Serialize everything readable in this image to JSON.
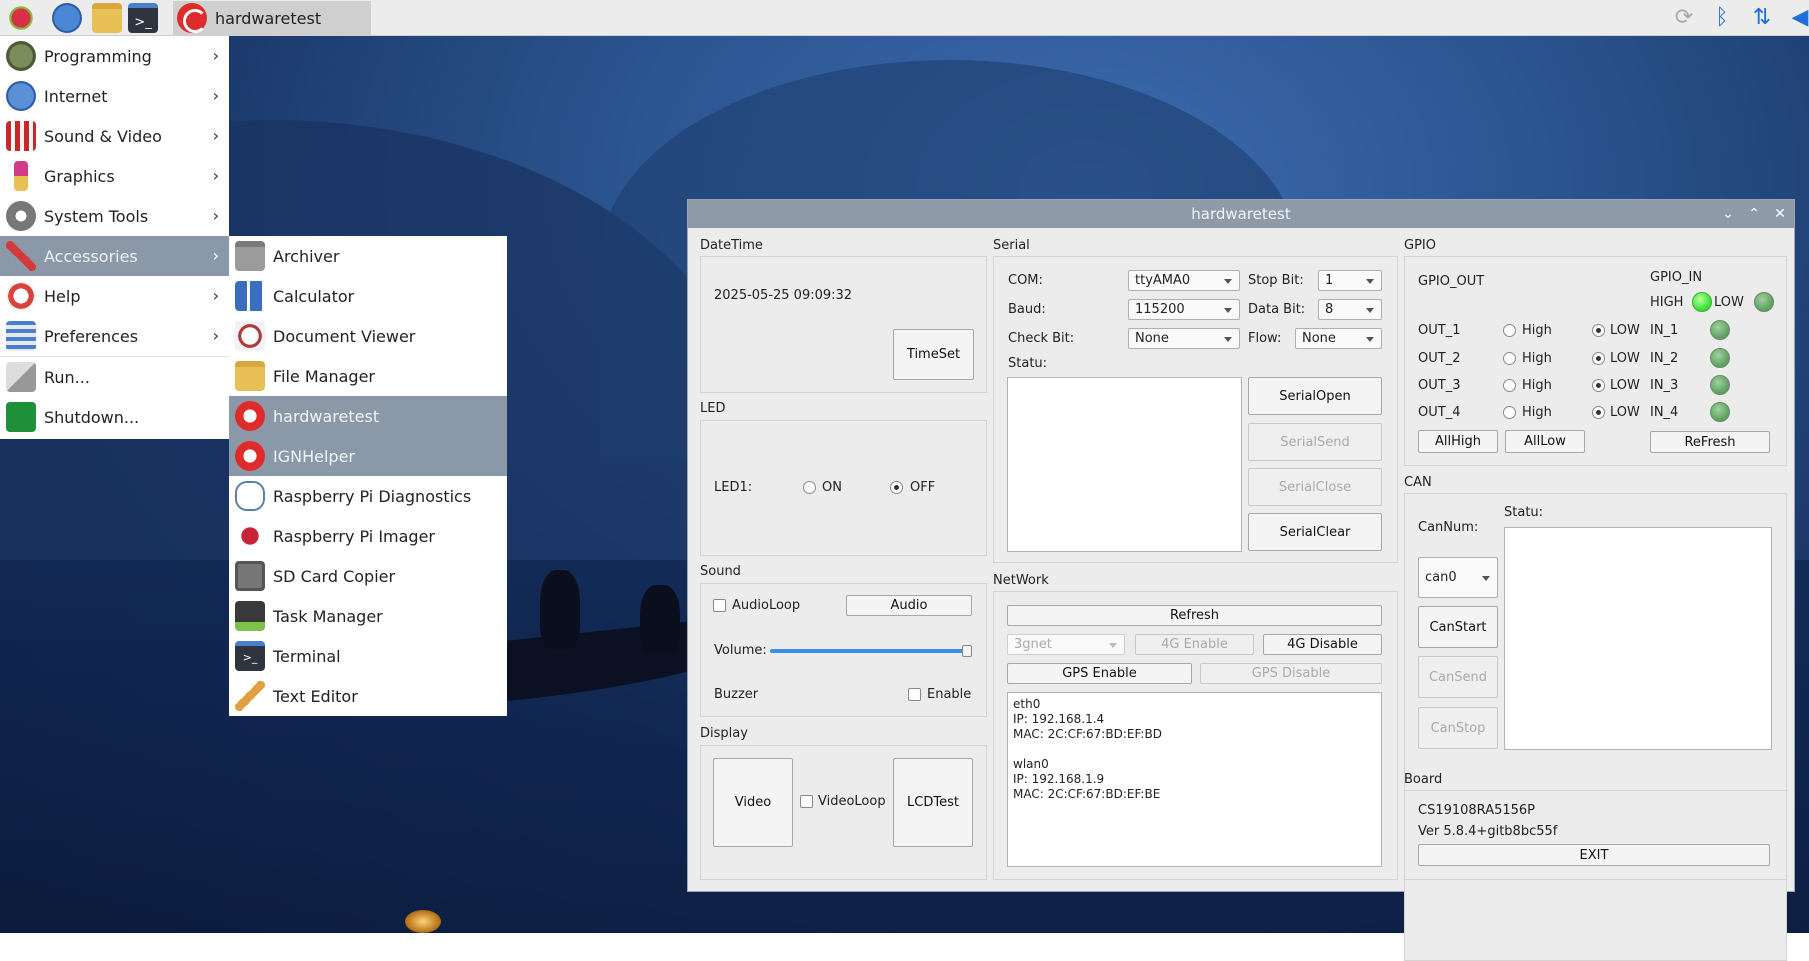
{
  "taskbar": {
    "app_title": "hardwaretest"
  },
  "main_menu": {
    "items": [
      {
        "label": "Programming"
      },
      {
        "label": "Internet"
      },
      {
        "label": "Sound & Video"
      },
      {
        "label": "Graphics"
      },
      {
        "label": "System Tools"
      },
      {
        "label": "Accessories"
      },
      {
        "label": "Help"
      },
      {
        "label": "Preferences"
      },
      {
        "label": "Run..."
      },
      {
        "label": "Shutdown..."
      }
    ]
  },
  "submenu": {
    "items": [
      {
        "label": "Archiver"
      },
      {
        "label": "Calculator"
      },
      {
        "label": "Document Viewer"
      },
      {
        "label": "File Manager"
      },
      {
        "label": "hardwaretest"
      },
      {
        "label": "IGNHelper"
      },
      {
        "label": "Raspberry Pi Diagnostics"
      },
      {
        "label": "Raspberry Pi Imager"
      },
      {
        "label": "SD Card Copier"
      },
      {
        "label": "Task Manager"
      },
      {
        "label": "Terminal"
      },
      {
        "label": "Text Editor"
      }
    ]
  },
  "window": {
    "title": "hardwaretest",
    "datetime": {
      "group": "DateTime",
      "value": "2025-05-25 09:09:32",
      "button": "TimeSet"
    },
    "led": {
      "group": "LED",
      "label": "LED1:",
      "on": "ON",
      "off": "OFF"
    },
    "sound": {
      "group": "Sound",
      "audioloop": "AudioLoop",
      "audio_btn": "Audio",
      "volume": "Volume:",
      "volume_level": 1.0,
      "buzzer": "Buzzer",
      "enable": "Enable"
    },
    "display": {
      "group": "Display",
      "video_btn": "Video",
      "videoloop": "VideoLoop",
      "lcdtest_btn": "LCDTest"
    },
    "serial": {
      "group": "Serial",
      "com_label": "COM:",
      "com_value": "ttyAMA0",
      "stop_label": "Stop Bit:",
      "stop_value": "1",
      "baud_label": "Baud:",
      "baud_value": "115200",
      "data_label": "Data Bit:",
      "data_value": "8",
      "check_label": "Check Bit:",
      "check_value": "None",
      "flow_label": "Flow:",
      "flow_value": "None",
      "statu_label": "Statu:",
      "open_btn": "SerialOpen",
      "send_btn": "SerialSend",
      "close_btn": "SerialClose",
      "clear_btn": "SerialClear"
    },
    "network": {
      "group": "NetWork",
      "refresh_btn": "Refresh",
      "apn_value": "3gnet",
      "g4_enable": "4G Enable",
      "g4_disable": "4G Disable",
      "gps_enable": "GPS Enable",
      "gps_disable": "GPS Disable",
      "info": "eth0\nIP: 192.168.1.4\nMAC: 2C:CF:67:BD:EF:BD\n\nwlan0\nIP: 192.168.1.9\nMAC: 2C:CF:67:BD:EF:BE"
    },
    "gpio": {
      "group": "GPIO",
      "out_title": "GPIO_OUT",
      "in_title": "GPIO_IN",
      "high": "HIGH",
      "low": "LOW",
      "outs": [
        "OUT_1",
        "OUT_2",
        "OUT_3",
        "OUT_4"
      ],
      "ins": [
        "IN_1",
        "IN_2",
        "IN_3",
        "IN_4"
      ],
      "high_label": "High",
      "low_label": "LOW",
      "allhigh_btn": "AllHigh",
      "alllow_btn": "AllLow",
      "refresh_btn": "ReFresh"
    },
    "can": {
      "group": "CAN",
      "canNum_label": "CanNum:",
      "statu_label": "Statu:",
      "can_value": "can0",
      "start_btn": "CanStart",
      "send_btn": "CanSend",
      "stop_btn": "CanStop"
    },
    "board": {
      "group": "Board",
      "model": "CS19108RA5156P",
      "version": "Ver 5.8.4+gitb8bc55f",
      "exit_btn": "EXIT"
    }
  }
}
